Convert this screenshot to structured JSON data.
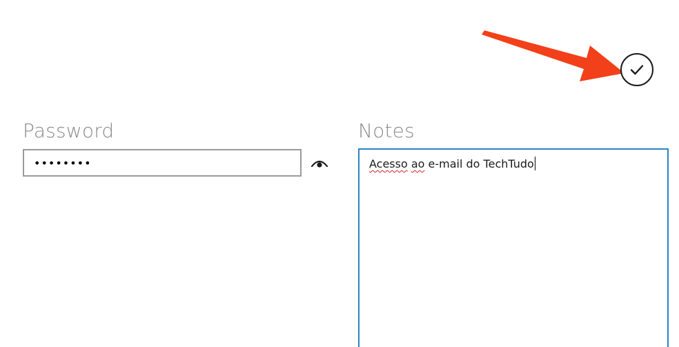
{
  "accept": {
    "icon": "checkmark-icon"
  },
  "password": {
    "label": "Password",
    "value": "••••••••",
    "reveal_icon": "eye-icon"
  },
  "notes": {
    "label": "Notes",
    "word1": "Acesso",
    "space1": " ",
    "word2": "ao",
    "rest": " e-mail do TechTudo"
  },
  "colors": {
    "arrow": "#f2401a",
    "notes_border": "#2a84c4",
    "label": "#8a8a8a"
  }
}
